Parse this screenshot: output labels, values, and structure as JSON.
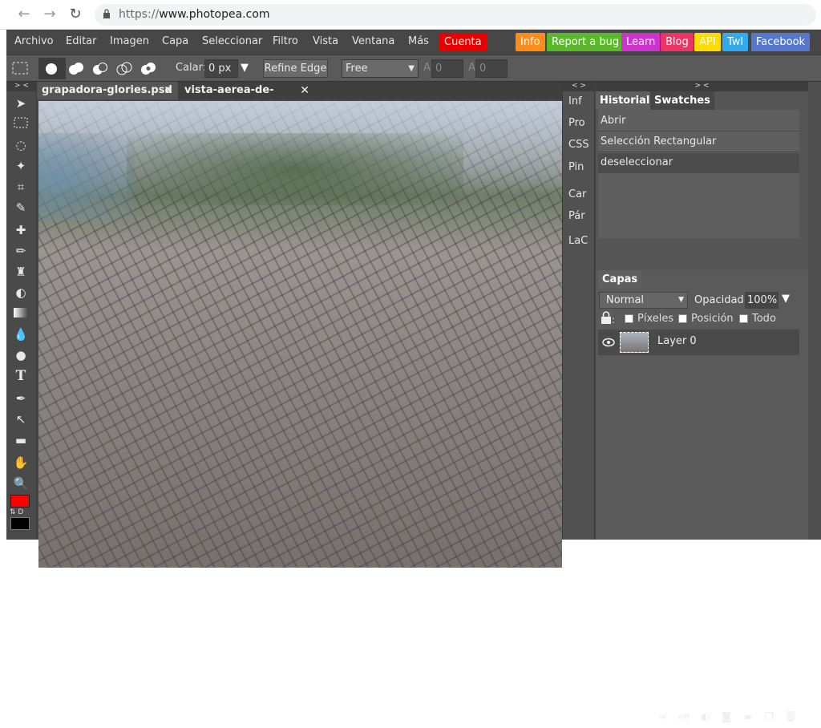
{
  "browser": {
    "url_scheme": "https://",
    "url_host": "www.photopea.com"
  },
  "menu": {
    "items": [
      "Archivo",
      "Editar",
      "Imagen",
      "Capa",
      "Seleccionar",
      "Filtro",
      "Vista",
      "Ventana",
      "Más"
    ],
    "account": "Cuenta",
    "links": [
      {
        "label": "Info",
        "color": "#ff8c1a"
      },
      {
        "label": "Report a bug",
        "color": "#5cb82b"
      },
      {
        "label": "Learn",
        "color": "#cc33cc"
      },
      {
        "label": "Blog",
        "color": "#ee3366"
      },
      {
        "label": "API",
        "color": "#ffdd00"
      },
      {
        "label": "Twl",
        "color": "#33aaee"
      },
      {
        "label": "Facebook",
        "color": "#5577cc"
      }
    ]
  },
  "options": {
    "feather_label": "Calar:",
    "feather_value": "0",
    "feather_unit": "px",
    "refine_edge": "Refine Edge",
    "style_value": "Free",
    "width_label": "A",
    "width_value": "0",
    "height_label": "A",
    "height_value": "0"
  },
  "tabs": [
    {
      "label": "grapadora-glories.psd",
      "close": "✕"
    },
    {
      "label": "vista-aerea-de-barce..",
      "close": "✕"
    }
  ],
  "side_panel": {
    "collapse_left": "> <",
    "collapse_mid": "< >",
    "collapse_right": "> <",
    "items": [
      "Inf",
      "Pro",
      "CSS",
      "Pin",
      "Car",
      "Pár",
      "LaC"
    ]
  },
  "history": {
    "tab_active": "Historial",
    "tab_other": "Swatches",
    "items": [
      "Abrir",
      "Selección Rectangular",
      "deseleccionar"
    ]
  },
  "layers": {
    "tab": "Capas",
    "blend_mode": "Normal",
    "opacity_label": "Opacidad:",
    "opacity_value": "100%",
    "lock_pixels": "Píxeles",
    "lock_position": "Posición",
    "lock_all": "Todo",
    "layer_name": "Layer 0",
    "footer_eff": "eff"
  },
  "colors": {
    "foreground": "#ff0000",
    "background": "#000000",
    "tool_swap_label": "D"
  }
}
